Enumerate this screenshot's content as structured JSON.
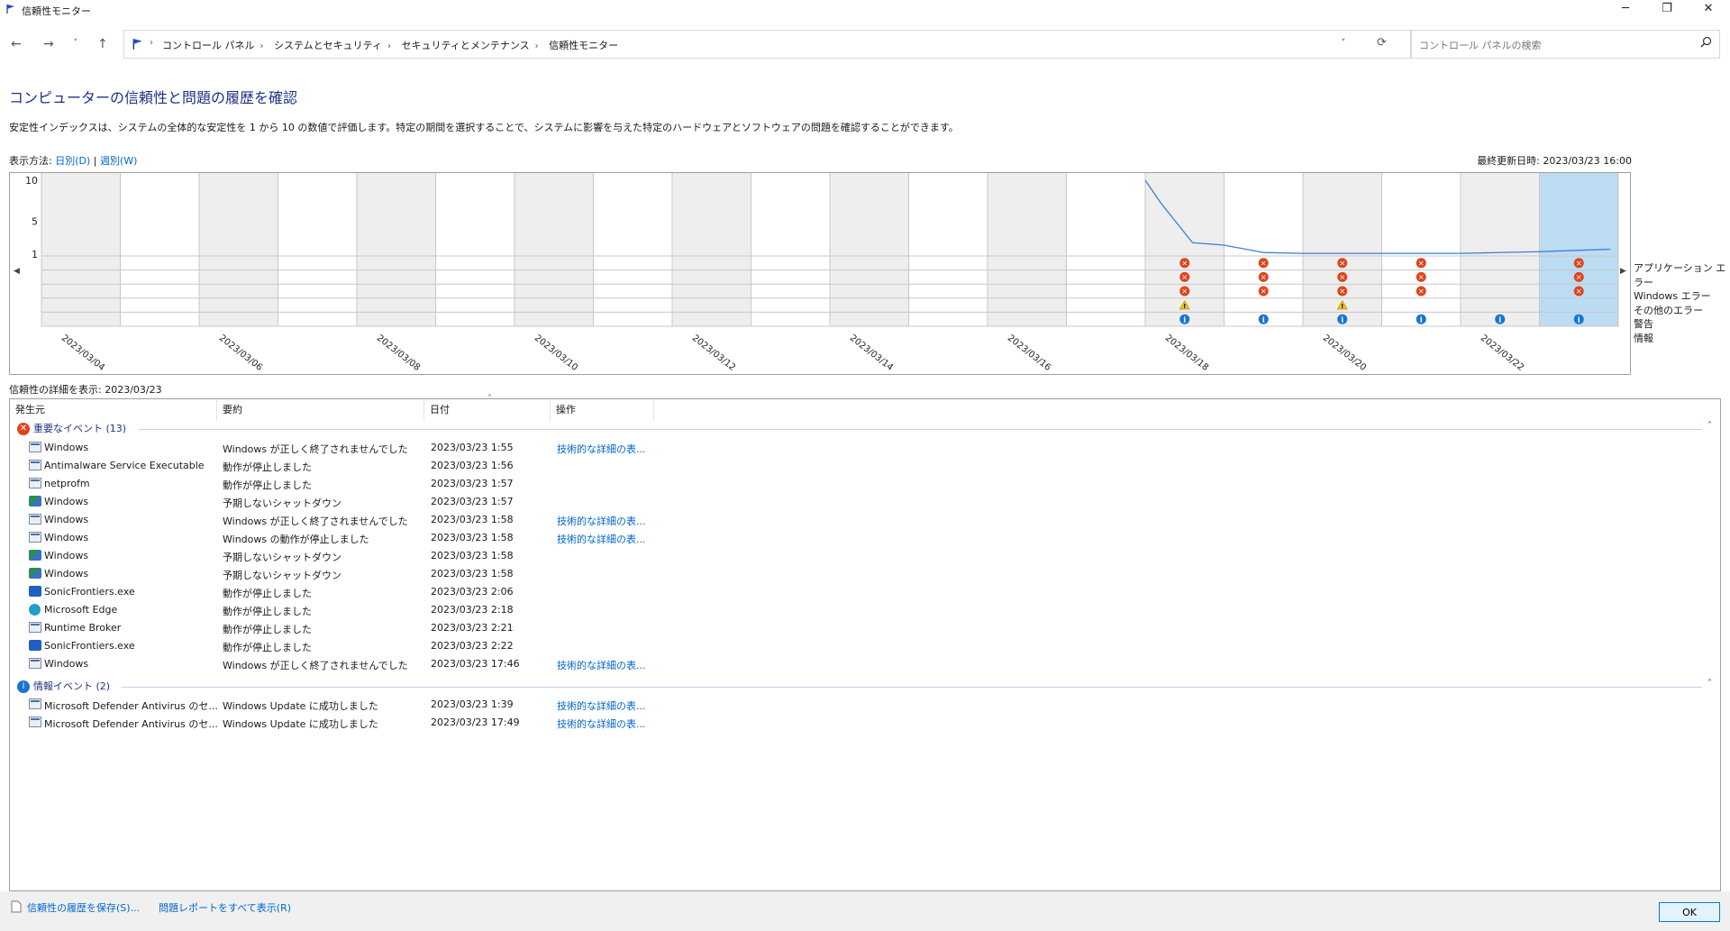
{
  "window": {
    "title": "信頼性モニター",
    "minimize": "─",
    "restore": "❐",
    "close": "✕"
  },
  "nav": {
    "back": "←",
    "forward": "→",
    "recent": "˅",
    "up": "↑"
  },
  "breadcrumb": [
    "コントロール パネル",
    "システムとセキュリティ",
    "セキュリティとメンテナンス",
    "信頼性モニター"
  ],
  "address": {
    "dropdown": "˅",
    "refresh": "⟳"
  },
  "search": {
    "placeholder": "コントロール パネルの検索"
  },
  "page": {
    "heading": "コンピューターの信頼性と問題の履歴を確認",
    "description": "安定性インデックスは、システムの全体的な安定性を 1 から 10 の数値で評価します。特定の期間を選択することで、システムに影響を与えた特定のハードウェアとソフトウェアの問題を確認することができます。",
    "view_by_label": "表示方法:",
    "view_daily": "日別(D)",
    "view_sep": "|",
    "view_weekly": "週別(W)",
    "last_updated": "最終更新日時: 2023/03/23 16:00"
  },
  "chart_data": {
    "type": "line",
    "y_ticks": [
      "10",
      "5",
      "1"
    ],
    "ylim": [
      1,
      10
    ],
    "row_labels": [
      "アプリケーション エラー",
      "Windows エラー",
      "その他のエラー",
      "警告",
      "情報"
    ],
    "date_labels": [
      "2023/03/04",
      "2023/03/06",
      "2023/03/08",
      "2023/03/10",
      "2023/03/12",
      "2023/03/14",
      "2023/03/16",
      "2023/03/18",
      "2023/03/20",
      "2023/03/22"
    ],
    "num_days": 20,
    "selected_day": 19,
    "stability_series": {
      "name": "安定性インデックス",
      "days": [
        14,
        14.2,
        14.6,
        15,
        15.5,
        16,
        17,
        18,
        19,
        19.9
      ],
      "values": [
        10,
        7.2,
        2.4,
        2.1,
        1.2,
        1.1,
        1.1,
        1.1,
        1.3,
        1.6
      ]
    },
    "events": [
      {
        "day": 14,
        "app": true,
        "win": true,
        "other": true,
        "warn": true,
        "info": true
      },
      {
        "day": 15,
        "app": true,
        "win": true,
        "other": true,
        "warn": false,
        "info": true
      },
      {
        "day": 16,
        "app": true,
        "win": true,
        "other": true,
        "warn": true,
        "info": true
      },
      {
        "day": 17,
        "app": true,
        "win": true,
        "other": true,
        "warn": false,
        "info": true
      },
      {
        "day": 18,
        "app": false,
        "win": false,
        "other": false,
        "warn": false,
        "info": true
      },
      {
        "day": 19,
        "app": true,
        "win": true,
        "other": true,
        "warn": false,
        "info": true
      }
    ]
  },
  "details": {
    "header": "信頼性の詳細を表示: 2023/03/23",
    "columns": [
      "発生元",
      "要約",
      "日付",
      "操作"
    ],
    "critical_group": "重要なイベント (13)",
    "info_group": "情報イベント (2)",
    "critical_rows": [
      {
        "icon": "window-icon",
        "source": "Windows",
        "summary": "Windows が正しく終了されませんでした",
        "date": "2023/03/23 1:55",
        "action": "技術的な詳細の表..."
      },
      {
        "icon": "window-icon",
        "source": "Antimalware Service Executable",
        "summary": "動作が停止しました",
        "date": "2023/03/23 1:56",
        "action": ""
      },
      {
        "icon": "window-icon",
        "source": "netprofm",
        "summary": "動作が停止しました",
        "date": "2023/03/23 1:57",
        "action": ""
      },
      {
        "icon": "shutdown-icon",
        "source": "Windows",
        "summary": "予期しないシャットダウン",
        "date": "2023/03/23 1:57",
        "action": ""
      },
      {
        "icon": "window-icon",
        "source": "Windows",
        "summary": "Windows が正しく終了されませんでした",
        "date": "2023/03/23 1:58",
        "action": "技術的な詳細の表..."
      },
      {
        "icon": "window-icon",
        "source": "Windows",
        "summary": "Windows の動作が停止しました",
        "date": "2023/03/23 1:58",
        "action": "技術的な詳細の表..."
      },
      {
        "icon": "shutdown-icon",
        "source": "Windows",
        "summary": "予期しないシャットダウン",
        "date": "2023/03/23 1:58",
        "action": ""
      },
      {
        "icon": "shutdown-icon",
        "source": "Windows",
        "summary": "予期しないシャットダウン",
        "date": "2023/03/23 1:58",
        "action": ""
      },
      {
        "icon": "sonic-icon",
        "source": "SonicFrontiers.exe",
        "summary": "動作が停止しました",
        "date": "2023/03/23 2:06",
        "action": ""
      },
      {
        "icon": "edge-icon",
        "source": "Microsoft Edge",
        "summary": "動作が停止しました",
        "date": "2023/03/23 2:18",
        "action": ""
      },
      {
        "icon": "window-icon",
        "source": "Runtime Broker",
        "summary": "動作が停止しました",
        "date": "2023/03/23 2:21",
        "action": ""
      },
      {
        "icon": "sonic-icon",
        "source": "SonicFrontiers.exe",
        "summary": "動作が停止しました",
        "date": "2023/03/23 2:22",
        "action": ""
      },
      {
        "icon": "window-icon",
        "source": "Windows",
        "summary": "Windows が正しく終了されませんでした",
        "date": "2023/03/23 17:46",
        "action": "技術的な詳細の表..."
      }
    ],
    "info_rows": [
      {
        "icon": "window-icon",
        "source": "Microsoft Defender Antivirus のセ...",
        "summary": "Windows Update に成功しました",
        "date": "2023/03/23 1:39",
        "action": "技術的な詳細の表..."
      },
      {
        "icon": "window-icon",
        "source": "Microsoft Defender Antivirus のセ...",
        "summary": "Windows Update に成功しました",
        "date": "2023/03/23 17:49",
        "action": "技術的な詳細の表..."
      }
    ]
  },
  "footer": {
    "save_history": "信頼性の履歴を保存(S)...",
    "view_all_reports": "問題レポートをすべて表示(R)",
    "ok": "OK"
  },
  "colors": {
    "error": "#e0441c",
    "warning": "#f2c21b",
    "info": "#1875d1",
    "line": "#3a7fd5",
    "selected": "#bcdcf4",
    "heading": "#1e3287"
  }
}
